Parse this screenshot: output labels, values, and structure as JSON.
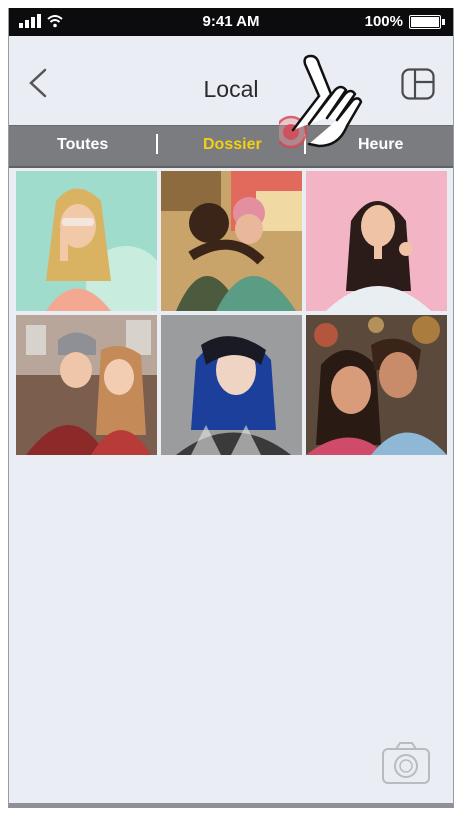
{
  "status": {
    "time": "9:41 AM",
    "battery": "100%"
  },
  "header": {
    "title": "Local"
  },
  "tabs": [
    {
      "label": "Toutes",
      "active": false
    },
    {
      "label": "Dossier",
      "active": true
    },
    {
      "label": "Heure",
      "active": false
    }
  ],
  "colors": {
    "tab_bar": "#7a7c80",
    "active_tab": "#f2cf14",
    "background": "#ebedf5"
  },
  "photos": [
    {
      "icon": "woman-with-balloon-photo"
    },
    {
      "icon": "couple-embracing-photo"
    },
    {
      "icon": "smiling-woman-pink-photo"
    },
    {
      "icon": "two-friends-winter-photo"
    },
    {
      "icon": "blue-hair-woman-photo"
    },
    {
      "icon": "smiling-couple-city-photo"
    }
  ]
}
